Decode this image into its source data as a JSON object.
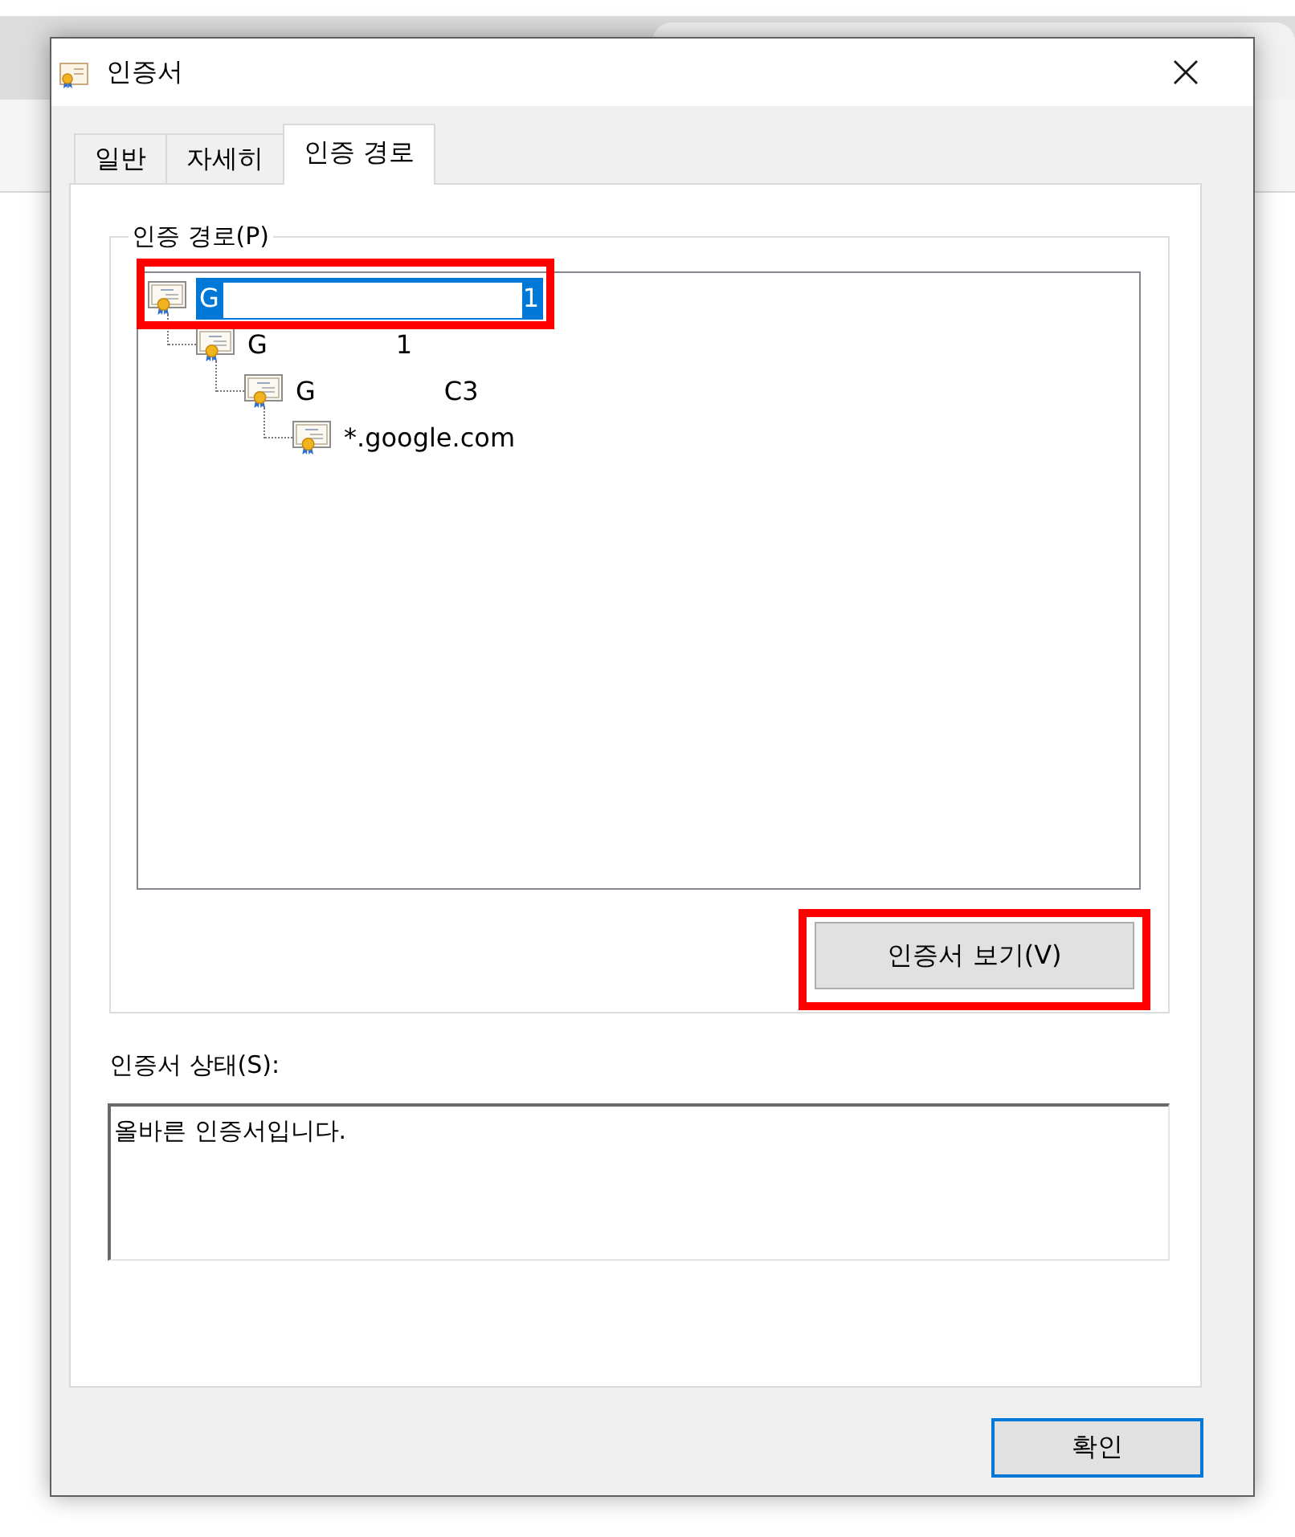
{
  "window": {
    "title": "인증서"
  },
  "tabs": [
    {
      "label": "일반",
      "selected": false
    },
    {
      "label": "자세히",
      "selected": false
    },
    {
      "label": "인증 경로",
      "selected": true
    }
  ],
  "certification_path": {
    "label": "인증 경로(P)",
    "tree": [
      {
        "label": "G",
        "label_end": "1",
        "selected": true,
        "redacted": true,
        "highlighted": true,
        "children": [
          {
            "label": "G",
            "label_end": "1",
            "selected": false,
            "children": [
              {
                "label": "G",
                "label_end": "C3",
                "selected": false,
                "children": [
                  {
                    "label": "*.google.com",
                    "selected": false
                  }
                ]
              }
            ]
          }
        ]
      }
    ],
    "view_button": {
      "label": "인증서 보기(V)",
      "highlighted": true
    }
  },
  "status": {
    "label": "인증서 상태(S):",
    "value": "올바른 인증서입니다."
  },
  "buttons": [
    {
      "label": "확인",
      "default": true
    }
  ]
}
